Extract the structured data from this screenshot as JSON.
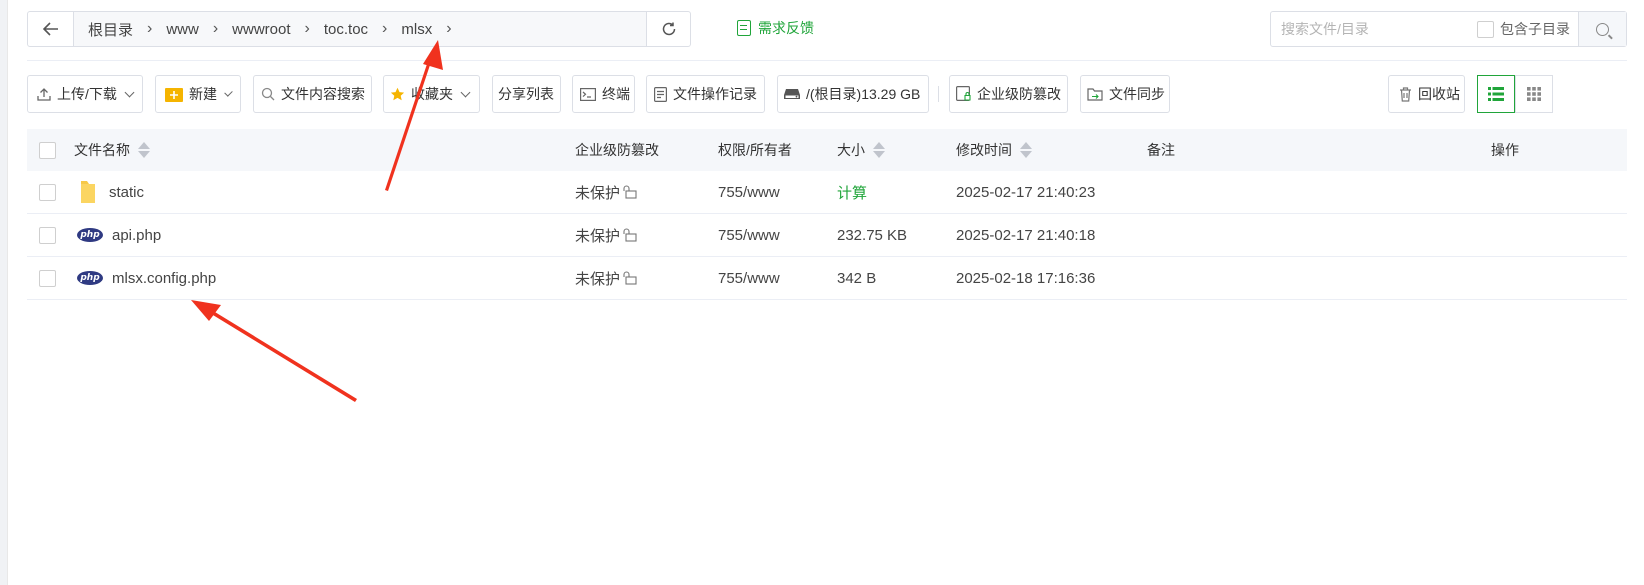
{
  "nav": {
    "back_icon": "arrow-left-icon",
    "breadcrumbs": [
      "根目录",
      "www",
      "wwwroot",
      "toc.toc",
      "mlsx"
    ],
    "refresh_icon": "refresh-icon",
    "feedback_label": "需求反馈"
  },
  "search": {
    "placeholder": "搜索文件/目录",
    "include_subdir_label": "包含子目录"
  },
  "toolbar": {
    "upload_label": "上传/下载",
    "new_label": "新建",
    "content_search_label": "文件内容搜索",
    "favorites_label": "收藏夹",
    "share_list_label": "分享列表",
    "terminal_label": "终端",
    "file_log_label": "文件操作记录",
    "disk_label": "/(根目录)13.29 GB",
    "tamper_label": "企业级防篡改",
    "sync_label": "文件同步",
    "recycle_label": "回收站"
  },
  "table": {
    "headers": {
      "name": "文件名称",
      "protect": "企业级防篡改",
      "perm": "权限/所有者",
      "size": "大小",
      "mtime": "修改时间",
      "note": "备注",
      "ops": "操作"
    },
    "rows": [
      {
        "name": "static",
        "type": "folder",
        "protect": "未保护",
        "perm": "755/www",
        "size": "计算",
        "mtime": "2025-02-17 21:40:23"
      },
      {
        "name": "api.php",
        "type": "php",
        "protect": "未保护",
        "perm": "755/www",
        "size": "232.75 KB",
        "mtime": "2025-02-17 21:40:18"
      },
      {
        "name": "mlsx.config.php",
        "type": "php",
        "protect": "未保护",
        "perm": "755/www",
        "size": "342 B",
        "mtime": "2025-02-18 17:16:36"
      }
    ]
  },
  "colors": {
    "accent": "#20a53a",
    "annotation_arrow": "#f0321e",
    "php_badge": "#2f3a82"
  }
}
